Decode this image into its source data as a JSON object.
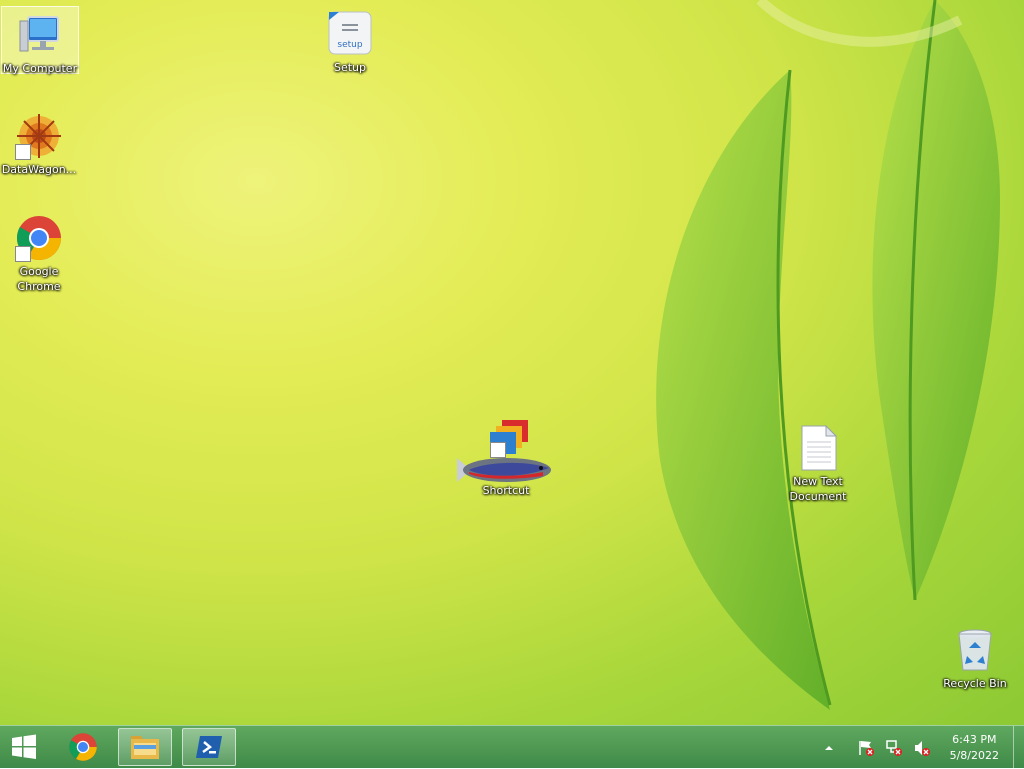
{
  "desktop": {
    "icons": [
      {
        "label": "My Computer",
        "icon": "computer-icon"
      },
      {
        "label": "Setup",
        "icon": "setup-icon"
      },
      {
        "label": "DataWagon...",
        "icon": "datawagon-icon"
      },
      {
        "label": "Google Chrome",
        "icon": "chrome-icon"
      },
      {
        "label": "WD",
        "label2": "Shortcut",
        "icon": "window-shortcut-icon"
      },
      {
        "label": "New Text Document",
        "icon": "text-document-icon"
      },
      {
        "label": "Recycle Bin",
        "icon": "recycle-bin-icon"
      }
    ]
  },
  "taskbar": {
    "start": {
      "icon": "windows-logo-icon"
    },
    "pinned": [
      {
        "icon": "chrome-icon"
      },
      {
        "icon": "file-explorer-icon"
      },
      {
        "icon": "powershell-icon"
      }
    ],
    "tray": {
      "icons": [
        "chevron-up-icon",
        "flag-alert-icon",
        "network-alert-icon",
        "volume-muted-icon"
      ],
      "time": "6:43 PM",
      "date": "5/8/2022"
    }
  },
  "colors": {
    "taskbar": "#4a9a52",
    "accent": "#8cc934"
  }
}
